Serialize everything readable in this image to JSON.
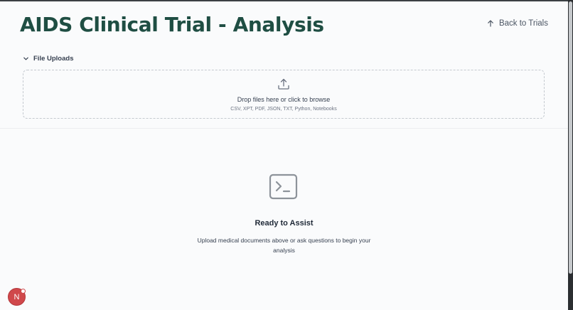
{
  "header": {
    "title": "AIDS Clinical Trial - Analysis",
    "back_label": "Back to Trials"
  },
  "uploads": {
    "section_label": "File Uploads",
    "drop_text": "Drop files here or click to browse",
    "file_types": "CSV, XPT, PDF, JSON, TXT, Python, Notebooks"
  },
  "empty_state": {
    "title": "Ready to Assist",
    "description": "Upload medical documents above or ask questions to begin your analysis"
  },
  "user": {
    "initial": "N"
  },
  "colors": {
    "title": "#1f4e43",
    "avatar": "#d0484b"
  },
  "icons": [
    "arrow-up-icon",
    "chevron-down-icon",
    "upload-icon",
    "terminal-icon"
  ]
}
